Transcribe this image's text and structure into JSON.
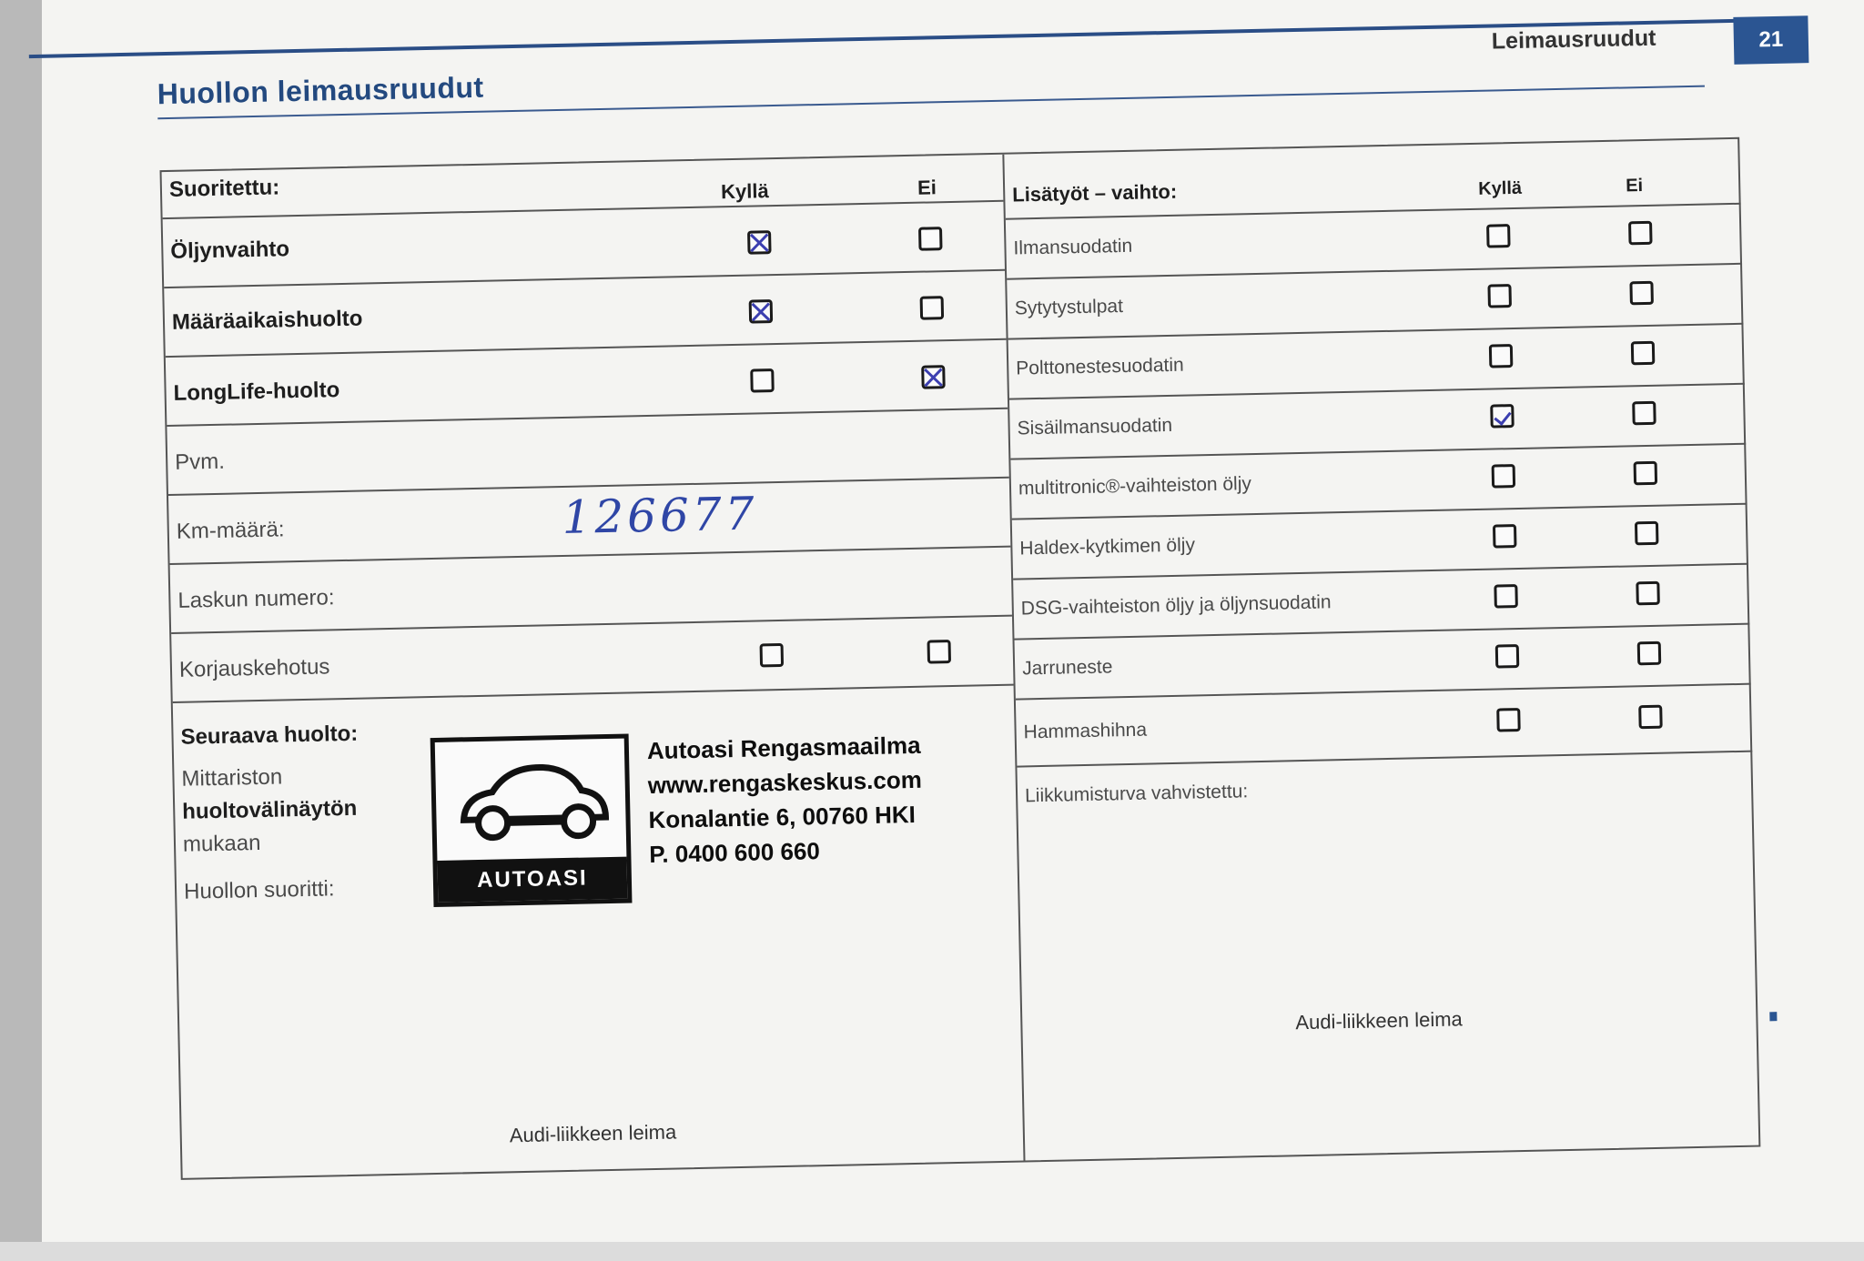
{
  "header": {
    "section_label": "Leimausruudut",
    "page_number": "21",
    "title": "Huollon leimausruudut"
  },
  "left_table": {
    "heading": "Suoritettu:",
    "col_yes": "Kyllä",
    "col_no": "Ei",
    "rows": [
      {
        "label": "Öljynvaihto",
        "yes": "checked",
        "no": "empty"
      },
      {
        "label": "Määräaikaishuolto",
        "yes": "checked",
        "no": "empty"
      },
      {
        "label": "LongLife-huolto",
        "yes": "empty",
        "no": "checked"
      },
      {
        "label": "Pvm."
      },
      {
        "label": "Km-määrä:",
        "value": "126677"
      },
      {
        "label": "Laskun numero:"
      },
      {
        "label": "Korjauskehotus",
        "yes": "empty",
        "no": "empty"
      }
    ],
    "next_service": {
      "title": "Seuraava huolto:",
      "line1": "Mittariston",
      "line2": "huoltovälinäytön",
      "line3": "mukaan"
    },
    "performed_by": "Huollon suoritti:",
    "footer": "Audi-liikkeen leima"
  },
  "right_table": {
    "heading": "Lisätyöt – vaihto:",
    "col_yes": "Kyllä",
    "col_no": "Ei",
    "rows": [
      {
        "label": "Ilmansuodatin",
        "yes": "empty",
        "no": "empty"
      },
      {
        "label": "Sytytystulpat",
        "yes": "empty",
        "no": "empty"
      },
      {
        "label": "Polttonestesuodatin",
        "yes": "empty",
        "no": "empty"
      },
      {
        "label": "Sisäilmansuodatin",
        "yes": "ticked",
        "no": "empty"
      },
      {
        "label": "multitronic®-vaihteiston öljy",
        "yes": "empty",
        "no": "empty"
      },
      {
        "label": "Haldex-kytkimen öljy",
        "yes": "empty",
        "no": "empty"
      },
      {
        "label": "DSG-vaihteiston öljy ja öljynsuodatin",
        "yes": "empty",
        "no": "empty"
      },
      {
        "label": "Jarruneste",
        "yes": "empty",
        "no": "empty"
      },
      {
        "label": "Hammashihna",
        "yes": "empty",
        "no": "empty"
      }
    ],
    "mobility": "Liikkumisturva vahvistettu:",
    "footer": "Audi-liikkeen leima"
  },
  "stamp": {
    "brand": "AUTOASI",
    "lines": [
      "Autoasi Rengasmaailma",
      "www.rengaskeskus.com",
      "Konalantie 6, 00760 HKI",
      "P. 0400 600 660"
    ]
  }
}
